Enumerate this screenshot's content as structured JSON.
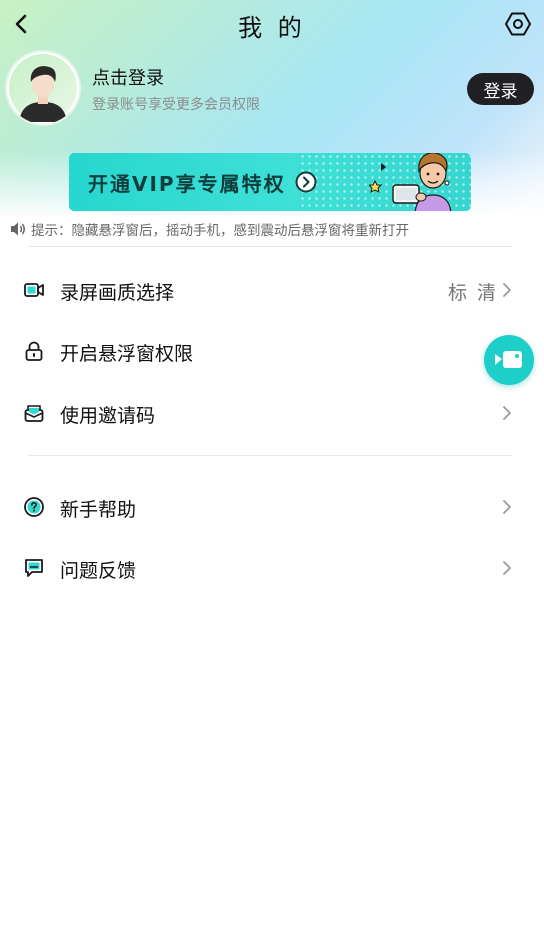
{
  "header": {
    "title": "我 的",
    "back_icon": "back-arrow-icon",
    "settings_icon": "hexagon-settings-icon"
  },
  "profile": {
    "name": "点击登录",
    "subtitle": "登录账号享受更多会员权限",
    "login_button": "登录"
  },
  "vip_banner": {
    "text": "开通VIP享专属特权",
    "accent": "#2fd9d1"
  },
  "tip": {
    "icon": "speaker-icon",
    "text": "提示：隐藏悬浮窗后，摇动手机，感到震动后悬浮窗将重新打开"
  },
  "menu": [
    {
      "label": "录屏画质选择",
      "value": "标 清",
      "icon": "video-camera-icon"
    },
    {
      "label": "开启悬浮窗权限",
      "value": "",
      "icon": "lock-icon"
    },
    {
      "label": "使用邀请码",
      "value": "",
      "icon": "invite-envelope-icon"
    },
    {
      "label": "新手帮助",
      "value": "",
      "icon": "help-question-icon"
    },
    {
      "label": "问题反馈",
      "value": "",
      "icon": "feedback-chat-icon"
    }
  ],
  "floating_button": {
    "icon": "record-camera-icon"
  },
  "colors": {
    "accent": "#1ecfc9",
    "dark_button": "#1f1f24"
  }
}
